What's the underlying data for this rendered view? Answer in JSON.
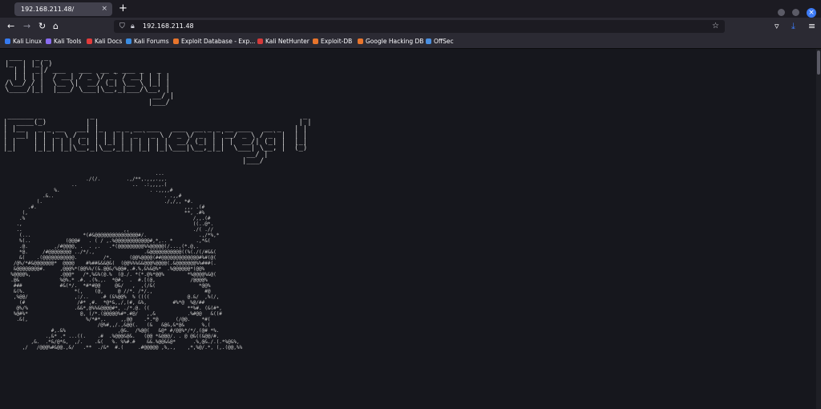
{
  "tab": {
    "title": "192.168.211.48/",
    "close_glyph": "×",
    "newtab_glyph": "+"
  },
  "window": {
    "close_glyph": "×"
  },
  "nav": {
    "back_glyph": "←",
    "forward_glyph": "→",
    "reload_glyph": "↻",
    "home_glyph": "⌂",
    "url": "192.168.211.48",
    "star_glyph": "☆",
    "pocket_glyph": "▿",
    "download_glyph": "⤓",
    "menu_glyph": "≡"
  },
  "bookmarks": [
    {
      "label": "Kali Linux",
      "color": "#367bf0"
    },
    {
      "label": "Kali Tools",
      "color": "#8a6cf0"
    },
    {
      "label": "Kali Docs",
      "color": "#e23b3b"
    },
    {
      "label": "Kali Forums",
      "color": "#3b8de2"
    },
    {
      "label": "Exploit Database - Exp...",
      "color": "#e8752c"
    },
    {
      "label": "Kali NetHunter",
      "color": "#d63a3a"
    },
    {
      "label": "Exploit-DB",
      "color": "#e8752c"
    },
    {
      "label": "Google Hacking DB",
      "color": "#e8752c"
    },
    {
      "label": "OffSec",
      "color": "#4a8fe0"
    }
  ],
  "content": {
    "banner_title": " ___   _ _\n|_  | |_( )\n  | |  _|/ ___   ___  __ _ ___ _   _\n  | | | |  / __| / _ \\/ _` / __| | | |\n/\\__/ / |  \\__ \\|  __/ (_| \\__ \\ |_| |\n\\____/|_|  |___/ \\___|\\__,_|___/\\__, |\n                                  __/ |\n                                 |___/",
    "banner_subtitle": " ______ _           _                                                _\n|  ____(_)         | |                                              | |\n| |__   _ _ __   __| |_   _ _ __ ___   ___  __ _ _ __ ___   __ _   | |\n|  __| | | '_ \\ / _` | | | | '_ ` _ \\ / _ \\/ _` | '__/ _ \\ / _` |  | |\n| |    | | | | | (_| | |_| | | | | | |  __/ (_| | | |  __/| (_| |  |_|\n|_|    |_|_| |_|\\__,_|\\__,_|_| |_| |_|\\___|\\__,_|_|  \\___| \\__, |  (_)\n                                                        __/ |\n                                                       |___/",
    "ascii_art": "                                                    ...\n                            ./(/.         .,/**,.,,,.,,.\n                       ..                   ..  .:,,,,.(\n                 %.                               . .,,,,#\n             .&..                                      . .,,#\n           (.                                          ./,/,, *#.\n        .#.                                                   ,,, .(#\n      (,                                                      **, .#%\n     .%                                                          /,,.(#\n    .,                                                           ((..@*.\n    ..                                   ,,                      ./( .//\n     (...                  *(#&@@@@@@@@@@@@@@@#/.                  .,/*%,*\n     %(..            (@@@#   . ( / ,.%@@@@@@@@@@@@#,*,.. *        .,*&(\n     .@.         ,/#@@@@, .  . ,.   .*(@@@@@@@@@%%@@@@@(/...,(*.@,.\n     *@.     /#@@@@@@@@ ../*/.,                 .&@@@@@@@@@@@((%(./(/#&&(\n     &(    .(@@@@@@@@@@@.         /*.      (@@%@@@@(##@@@@@@@@@@@@@#%#(@(\n   /@%/*#&@@@@@@@*  @@@@    #%##&&&@&(  (@@%%%&&@@@%@@@@(.&@@@@@@@%%###(.\n   &@@@@@@@@#.     ,@@@%*(@@%%/(&.@@&/%@@#,.#.%,&%&@%*  .%@@@@@@*(@@%\n  %@@@@%,          .@@@*   /*,%&%(@.%  (@./. *(*.@%*@@%        *%@@@@%&@(\n  .@&              %@%.* .#. .(%.,.  *@#.  .  #.[(@,            /@@@@%\n   ###             #&(*/.  *#*#@@     @&/   ,  ,(/&(               *@@%\n   &(%.                 *(,    (@,     @ //*. /*/.,                  #@\n   ,%@@/                ,:/..    .# (&%@@%  % ((((             @.&/  ,%(/,\n     (#                  /#* ,#.  *@*&,,/,(#, &%,         #%*@  %@/##\n    @%/%                .&&*,@%%&@@@@#*, ./*.@. ((             **%#. (&(#*,\n   %@#%*                  @, (/*.(@@@@@%#*.#@/   ,,&           .%#@@   &((#\n    .&(,                    %/*#*,.     ,,@@    .*.*@      (/@@.    *#(\n                                /@%#,,/.,&@@(.   (&   &@&,&*@&      %,(\n                #,.&%                  ,@&.  /%@@(   &@* #/@@%*/*/,(@# *%.\n              .,&* .* ...((.    .#  .%@@@&@&.   (@@ *&@@@/. . @ @&((&@@/#.\n         ,&.  .*&/@*&,  ,/.    .&(   %. %%#.#    &&.%@@&&@*      .%,@&./.(.*%@&%,\n      ,/   /@@@%#&@@.,&/   .**  ./&*  #.(     .#@@@@@ ,%,.,    ,*,%@/.*, (,.(@@,%%\n"
  }
}
